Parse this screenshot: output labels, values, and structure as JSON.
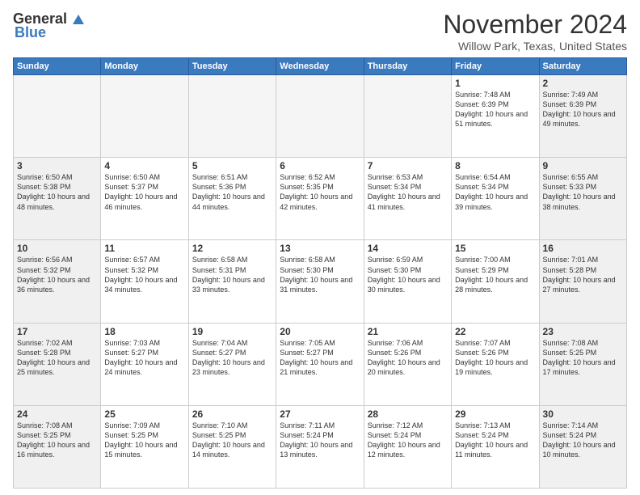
{
  "header": {
    "logo_general": "General",
    "logo_blue": "Blue",
    "month_title": "November 2024",
    "location": "Willow Park, Texas, United States"
  },
  "days_of_week": [
    "Sunday",
    "Monday",
    "Tuesday",
    "Wednesday",
    "Thursday",
    "Friday",
    "Saturday"
  ],
  "weeks": [
    [
      {
        "day": "",
        "empty": true
      },
      {
        "day": "",
        "empty": true
      },
      {
        "day": "",
        "empty": true
      },
      {
        "day": "",
        "empty": true
      },
      {
        "day": "",
        "empty": true
      },
      {
        "day": "1",
        "sunrise": "7:48 AM",
        "sunset": "6:39 PM",
        "daylight": "10 hours and 51 minutes."
      },
      {
        "day": "2",
        "sunrise": "7:49 AM",
        "sunset": "6:39 PM",
        "daylight": "10 hours and 49 minutes."
      }
    ],
    [
      {
        "day": "3",
        "sunrise": "6:50 AM",
        "sunset": "5:38 PM",
        "daylight": "10 hours and 48 minutes."
      },
      {
        "day": "4",
        "sunrise": "6:50 AM",
        "sunset": "5:37 PM",
        "daylight": "10 hours and 46 minutes."
      },
      {
        "day": "5",
        "sunrise": "6:51 AM",
        "sunset": "5:36 PM",
        "daylight": "10 hours and 44 minutes."
      },
      {
        "day": "6",
        "sunrise": "6:52 AM",
        "sunset": "5:35 PM",
        "daylight": "10 hours and 42 minutes."
      },
      {
        "day": "7",
        "sunrise": "6:53 AM",
        "sunset": "5:34 PM",
        "daylight": "10 hours and 41 minutes."
      },
      {
        "day": "8",
        "sunrise": "6:54 AM",
        "sunset": "5:34 PM",
        "daylight": "10 hours and 39 minutes."
      },
      {
        "day": "9",
        "sunrise": "6:55 AM",
        "sunset": "5:33 PM",
        "daylight": "10 hours and 38 minutes."
      }
    ],
    [
      {
        "day": "10",
        "sunrise": "6:56 AM",
        "sunset": "5:32 PM",
        "daylight": "10 hours and 36 minutes."
      },
      {
        "day": "11",
        "sunrise": "6:57 AM",
        "sunset": "5:32 PM",
        "daylight": "10 hours and 34 minutes."
      },
      {
        "day": "12",
        "sunrise": "6:58 AM",
        "sunset": "5:31 PM",
        "daylight": "10 hours and 33 minutes."
      },
      {
        "day": "13",
        "sunrise": "6:58 AM",
        "sunset": "5:30 PM",
        "daylight": "10 hours and 31 minutes."
      },
      {
        "day": "14",
        "sunrise": "6:59 AM",
        "sunset": "5:30 PM",
        "daylight": "10 hours and 30 minutes."
      },
      {
        "day": "15",
        "sunrise": "7:00 AM",
        "sunset": "5:29 PM",
        "daylight": "10 hours and 28 minutes."
      },
      {
        "day": "16",
        "sunrise": "7:01 AM",
        "sunset": "5:28 PM",
        "daylight": "10 hours and 27 minutes."
      }
    ],
    [
      {
        "day": "17",
        "sunrise": "7:02 AM",
        "sunset": "5:28 PM",
        "daylight": "10 hours and 25 minutes."
      },
      {
        "day": "18",
        "sunrise": "7:03 AM",
        "sunset": "5:27 PM",
        "daylight": "10 hours and 24 minutes."
      },
      {
        "day": "19",
        "sunrise": "7:04 AM",
        "sunset": "5:27 PM",
        "daylight": "10 hours and 23 minutes."
      },
      {
        "day": "20",
        "sunrise": "7:05 AM",
        "sunset": "5:27 PM",
        "daylight": "10 hours and 21 minutes."
      },
      {
        "day": "21",
        "sunrise": "7:06 AM",
        "sunset": "5:26 PM",
        "daylight": "10 hours and 20 minutes."
      },
      {
        "day": "22",
        "sunrise": "7:07 AM",
        "sunset": "5:26 PM",
        "daylight": "10 hours and 19 minutes."
      },
      {
        "day": "23",
        "sunrise": "7:08 AM",
        "sunset": "5:25 PM",
        "daylight": "10 hours and 17 minutes."
      }
    ],
    [
      {
        "day": "24",
        "sunrise": "7:08 AM",
        "sunset": "5:25 PM",
        "daylight": "10 hours and 16 minutes."
      },
      {
        "day": "25",
        "sunrise": "7:09 AM",
        "sunset": "5:25 PM",
        "daylight": "10 hours and 15 minutes."
      },
      {
        "day": "26",
        "sunrise": "7:10 AM",
        "sunset": "5:25 PM",
        "daylight": "10 hours and 14 minutes."
      },
      {
        "day": "27",
        "sunrise": "7:11 AM",
        "sunset": "5:24 PM",
        "daylight": "10 hours and 13 minutes."
      },
      {
        "day": "28",
        "sunrise": "7:12 AM",
        "sunset": "5:24 PM",
        "daylight": "10 hours and 12 minutes."
      },
      {
        "day": "29",
        "sunrise": "7:13 AM",
        "sunset": "5:24 PM",
        "daylight": "10 hours and 11 minutes."
      },
      {
        "day": "30",
        "sunrise": "7:14 AM",
        "sunset": "5:24 PM",
        "daylight": "10 hours and 10 minutes."
      }
    ]
  ]
}
